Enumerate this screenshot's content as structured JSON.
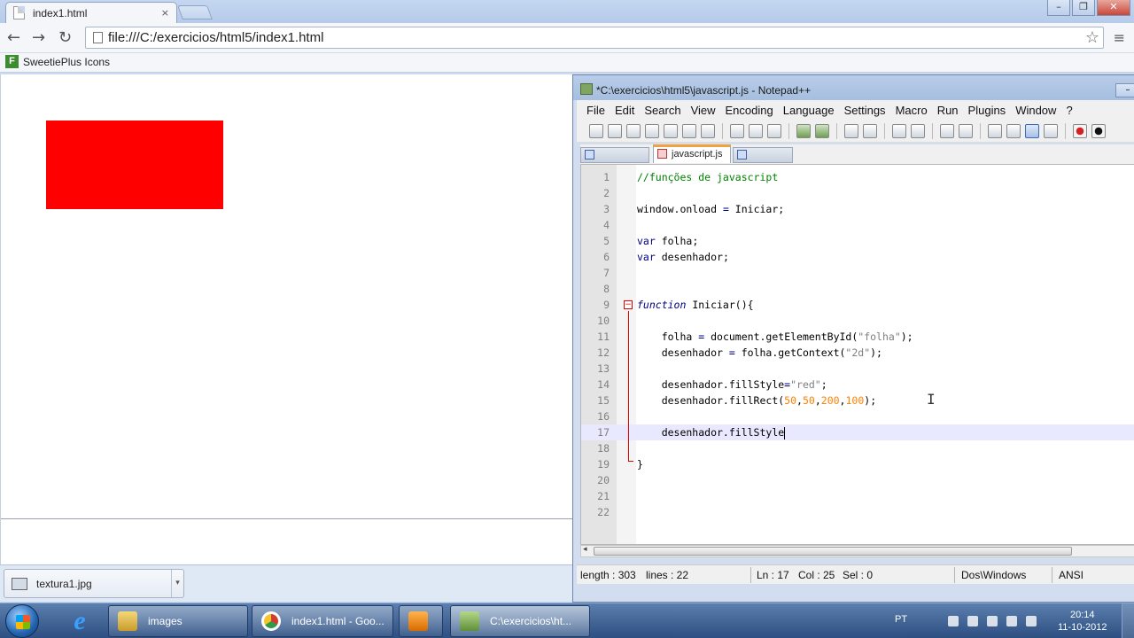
{
  "browser": {
    "tab_title": "index1.html",
    "tab_close": "×",
    "url": "file:///C:/exercicios/html5/index1.html",
    "back": "←",
    "forward": "→",
    "reload": "↻",
    "star": "☆",
    "wrench": "≡",
    "bookmark_label": "SweetiePlus Icons",
    "bookmark_icon_letter": "F",
    "canvas_rect_color": "#ff0000",
    "download_filename": "textura1.jpg",
    "window_min": "–",
    "window_max": "❐",
    "window_close": "✕"
  },
  "notepad": {
    "title": "*C:\\exercicios\\html5\\javascript.js - Notepad++",
    "minimize": "–",
    "menu": [
      "File",
      "Edit",
      "Search",
      "View",
      "Encoding",
      "Language",
      "Settings",
      "Macro",
      "Run",
      "Plugins",
      "Window",
      "?"
    ],
    "active_tab": "javascript.js",
    "current_line": 17,
    "status": {
      "length": "length : 303",
      "lines": "lines : 22",
      "ln": "Ln : 17",
      "col": "Col : 25",
      "sel": "Sel : 0",
      "eol": "Dos\\Windows",
      "encoding": "ANSI"
    }
  },
  "taskbar": {
    "items": [
      {
        "label": "images",
        "icon": "folder-icon"
      },
      {
        "label": "index1.html - Goo...",
        "icon": "chrome-icon"
      },
      {
        "label": "",
        "icon": "media-icon"
      },
      {
        "label": "C:\\exercicios\\ht...",
        "icon": "notepad-icon"
      }
    ],
    "lang": "PT",
    "time": "20:14",
    "date": "11-10-2012"
  }
}
